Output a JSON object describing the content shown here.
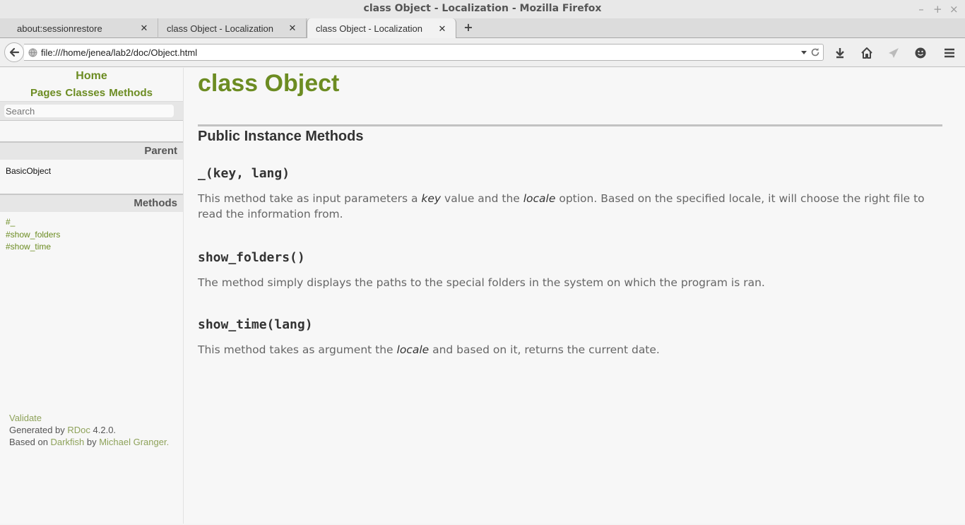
{
  "window": {
    "title": "class Object - Localization - Mozilla Firefox",
    "controls": {
      "minimize": "–",
      "maximize": "+",
      "close": "×"
    }
  },
  "tabs": [
    {
      "label": "about:sessionrestore",
      "close": "✕",
      "active": false
    },
    {
      "label": "class Object - Localization",
      "close": "✕",
      "active": false
    },
    {
      "label": "class Object - Localization",
      "close": "✕",
      "active": true
    }
  ],
  "newtab_label": "+",
  "navbar": {
    "url": "file:///home/jenea/lab2/doc/Object.html"
  },
  "sidebar": {
    "home": "Home",
    "nav": {
      "pages": "Pages",
      "classes": "Classes",
      "methods": "Methods"
    },
    "search_placeholder": "Search",
    "parent_head": "Parent",
    "parent_link": "BasicObject",
    "methods_head": "Methods",
    "methods": [
      "#_",
      "#show_folders",
      "#show_time"
    ]
  },
  "footer": {
    "validate": "Validate",
    "generated_prefix": "Generated by ",
    "rdoc": "RDoc",
    "rdoc_version": " 4.2.0.",
    "based_prefix": "Based on ",
    "darkfish": "Darkfish",
    "by": " by ",
    "author": "Michael Granger",
    "period": "."
  },
  "main": {
    "title": "class Object",
    "section": "Public Instance Methods",
    "methods": [
      {
        "sig": "_(key, lang)",
        "desc_1": "This method take as input parameters a ",
        "em_1": "key",
        "desc_2": " value and the ",
        "em_2": "locale",
        "desc_3": " option. Based on the specified locale, it will choose the right file to read the information from."
      },
      {
        "sig": "show_folders()",
        "desc": "The method simply displays the paths to the special folders in the system on which the program is ran."
      },
      {
        "sig": "show_time(lang)",
        "desc_1": "This method takes as argument the ",
        "em_1": "locale",
        "desc_2": " and based on it, returns the current date."
      }
    ]
  },
  "colors": {
    "accent": "#6c8c22",
    "footer_link": "#8ea25a"
  }
}
